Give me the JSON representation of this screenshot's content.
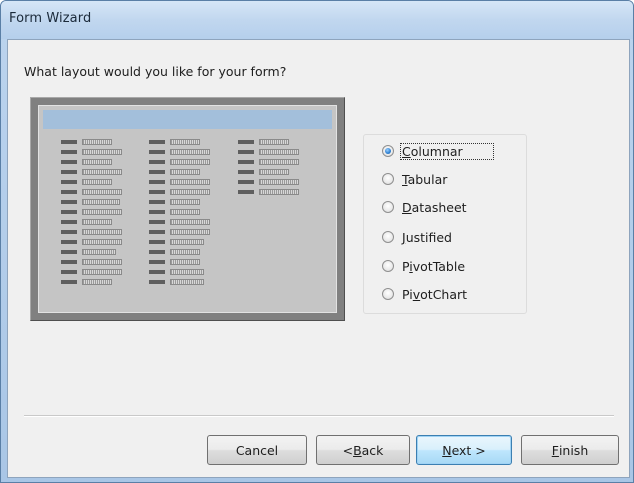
{
  "window": {
    "title": "Form Wizard"
  },
  "wizard": {
    "prompt": "What layout would you like for your form?",
    "options": [
      {
        "pre": "",
        "key": "C",
        "post": "olumnar",
        "selected": true
      },
      {
        "pre": "",
        "key": "T",
        "post": "abular",
        "selected": false
      },
      {
        "pre": "",
        "key": "D",
        "post": "atasheet",
        "selected": false
      },
      {
        "pre": "",
        "key": "J",
        "post": "ustified",
        "selected": false
      },
      {
        "pre": "P",
        "key": "i",
        "post": "votTable",
        "selected": false
      },
      {
        "pre": "Pi",
        "key": "v",
        "post": "otChart",
        "selected": false
      }
    ]
  },
  "buttons": {
    "cancel": "Cancel",
    "back": {
      "pre": "< ",
      "key": "B",
      "post": "ack"
    },
    "next": {
      "pre": "",
      "key": "N",
      "post": "ext >"
    },
    "finish": {
      "pre": "",
      "key": "F",
      "post": "inish"
    }
  },
  "colors": {
    "title_bar": "#c1d7ef",
    "dialog_bg": "#f0f0f0",
    "preview_header": "#a3bfdb",
    "default_button": "#bee6fd"
  }
}
